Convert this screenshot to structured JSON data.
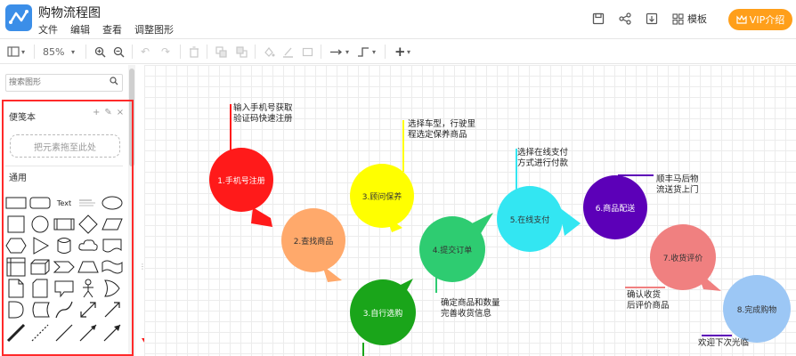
{
  "app": {
    "title": "购物流程图",
    "menu": [
      "文件",
      "编辑",
      "查看",
      "调整图形"
    ]
  },
  "header": {
    "template_label": "模板",
    "vip_label": "VIP介绍"
  },
  "toolbar": {
    "zoom": "85%"
  },
  "sidebar": {
    "search_placeholder": "搜索图形",
    "favorites_title": "便笺本",
    "dropzone_text": "把元素拖至此处",
    "general_title": "通用",
    "text_shape_label": "Text"
  },
  "flow": {
    "steps": [
      {
        "label": "1.手机号注册",
        "color": "#ff1a1a",
        "text_color": "#ffffff"
      },
      {
        "label": "2.查找商品",
        "color": "#ffa96b",
        "text_color": "#333333"
      },
      {
        "label": "3.顾问保养",
        "color": "#ffff00",
        "text_color": "#333333"
      },
      {
        "label": "3.自行选购",
        "color": "#1aa51a",
        "text_color": "#ffffff"
      },
      {
        "label": "4.提交订单",
        "color": "#2ecc71",
        "text_color": "#333333"
      },
      {
        "label": "5.在线支付",
        "color": "#33e6f2",
        "text_color": "#333333"
      },
      {
        "label": "6.商品配送",
        "color": "#5c00b8",
        "text_color": "#ffffff"
      },
      {
        "label": "7.收货评价",
        "color": "#f08080",
        "text_color": "#333333"
      },
      {
        "label": "8.完成购物",
        "color": "#9cc7f5",
        "text_color": "#333333"
      }
    ],
    "notes": [
      {
        "lines": [
          "输入手机号获取",
          "验证码快速注册"
        ]
      },
      {
        "lines": [
          "选择车型，行驶里",
          "程选定保养商品"
        ]
      },
      {
        "lines": [
          "选择在线支付",
          "方式进行付款"
        ]
      },
      {
        "lines": [
          "顺丰马后物",
          "流送货上门"
        ]
      },
      {
        "lines": [
          "确定商品和数量",
          "完善收货信息"
        ]
      },
      {
        "lines": [
          "确认收货",
          "后评价商品"
        ]
      },
      {
        "lines": [
          "欢迎下次光临"
        ]
      }
    ]
  },
  "colors": {
    "brand": "#3b8ee8",
    "vip": "#ff9f1a",
    "highlight": "#ff2a2a"
  }
}
